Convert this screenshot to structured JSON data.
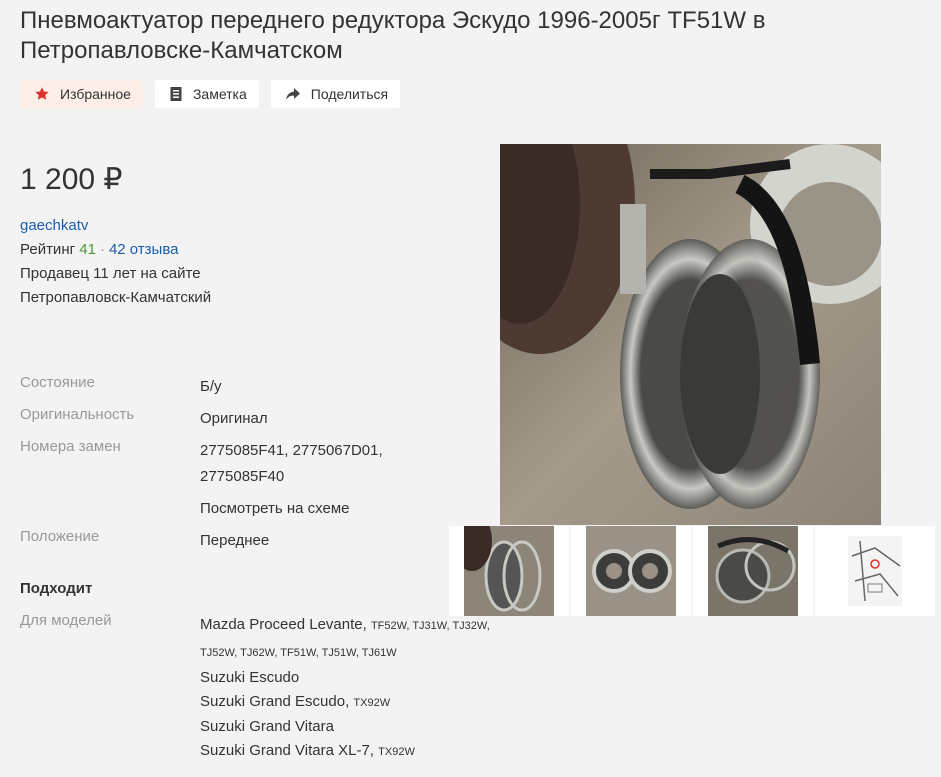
{
  "title": "Пневмоактуатор переднего редуктора Эскудо 1996-2005г TF51W в Петропавловске-Камчатском",
  "actions": {
    "favorite": "Избранное",
    "note": "Заметка",
    "share": "Поделиться"
  },
  "price": "1 200 ₽",
  "seller": {
    "name": "gaechkatv",
    "rating_label": "Рейтинг",
    "rating": "41",
    "reviews": "42 отзыва",
    "since": "Продавец 11 лет на сайте",
    "city": "Петропавловск-Камчатский"
  },
  "specs": {
    "condition_label": "Состояние",
    "condition": "Б/у",
    "originality_label": "Оригинальность",
    "originality": "Оригинал",
    "replacements_label": "Номера замен",
    "replacements": "2775085F41, 2775067D01, 2775085F40",
    "scheme_link": "Посмотреть на схеме",
    "position_label": "Положение",
    "position": "Переднее"
  },
  "fits": {
    "heading": "Подходит",
    "models_label": "Для моделей",
    "m1_name": "Mazda Proceed Levante,",
    "m1_codes": "TF52W, TJ31W, TJ32W, TJ52W, TJ62W, TF51W, TJ51W, TJ61W",
    "m2": "Suzuki Escudo",
    "m3_name": "Suzuki Grand Escudo,",
    "m3_codes": "TX92W",
    "m4": "Suzuki Grand Vitara",
    "m5_name": "Suzuki Grand Vitara XL-7,",
    "m5_codes": "TX92W"
  },
  "colors": {
    "link": "#1a5dab",
    "rating": "#4a9a3a",
    "favorite_star": "#e0302a"
  }
}
